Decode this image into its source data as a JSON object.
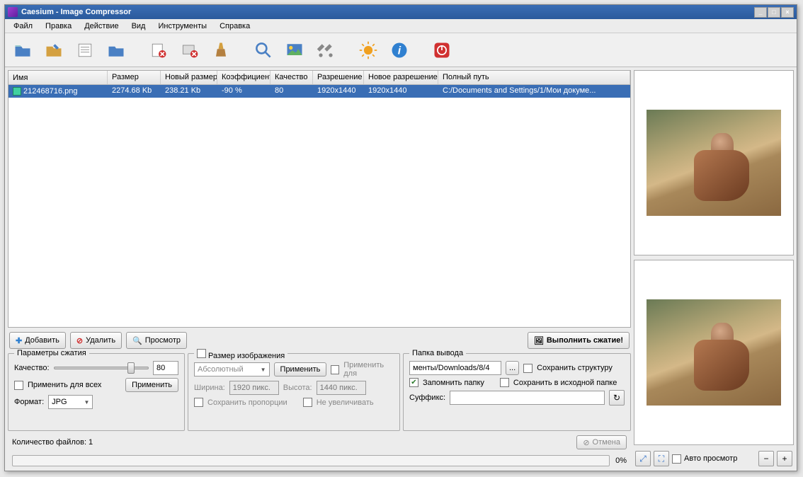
{
  "title": "Caesium - Image Compressor",
  "menu": [
    "Файл",
    "Правка",
    "Действие",
    "Вид",
    "Инструменты",
    "Справка"
  ],
  "table": {
    "headers": [
      "Имя",
      "Размер",
      "Новый размер",
      "Коэффициент",
      "Качество",
      "Разрешение",
      "Новое разрешение",
      "Полный путь"
    ],
    "rows": [
      {
        "name": "212468716.png",
        "size": "2274.68 Kb",
        "newsize": "238.21 Kb",
        "ratio": "-90 %",
        "quality": "80",
        "res": "1920x1440",
        "newres": "1920x1440",
        "path": "C:/Documents and Settings/1/Мои докуме..."
      }
    ]
  },
  "actions": {
    "add": "Добавить",
    "remove": "Удалить",
    "preview": "Просмотр",
    "compress": "Выполнить сжатие!"
  },
  "panels": {
    "compress": {
      "title": "Параметры сжатия",
      "quality_label": "Качество:",
      "quality_value": "80",
      "apply_all_label": "Применить для всех",
      "apply_btn": "Применить",
      "format_label": "Формат:",
      "format_value": "JPG"
    },
    "size": {
      "title": "Размер изображения",
      "checkbox_label": "",
      "scale_placeholder": "Абсолютный",
      "apply_btn": "Применить",
      "apply_for_label": "Применить для",
      "width_label": "Ширина:",
      "width_placeholder": "1920 пикс.",
      "height_label": "Высота:",
      "height_placeholder": "1440 пикс.",
      "keep_ratio_label": "Сохранить пропорции",
      "no_enlarge_label": "Не увеличивать"
    },
    "output": {
      "title": "Папка вывода",
      "path_value": "менты/Downloads/8/4",
      "browse_btn": "...",
      "keep_structure_label": "Сохранить структуру",
      "remember_folder_label": "Запомнить папку",
      "save_source_label": "Сохранить в исходной папке",
      "suffix_label": "Суффикс:",
      "suffix_value": ""
    }
  },
  "status": {
    "file_count_label": "Количество файлов: 1",
    "cancel_btn": "Отмена",
    "progress": "0%"
  },
  "preview": {
    "auto_preview_label": "Авто просмотр"
  }
}
